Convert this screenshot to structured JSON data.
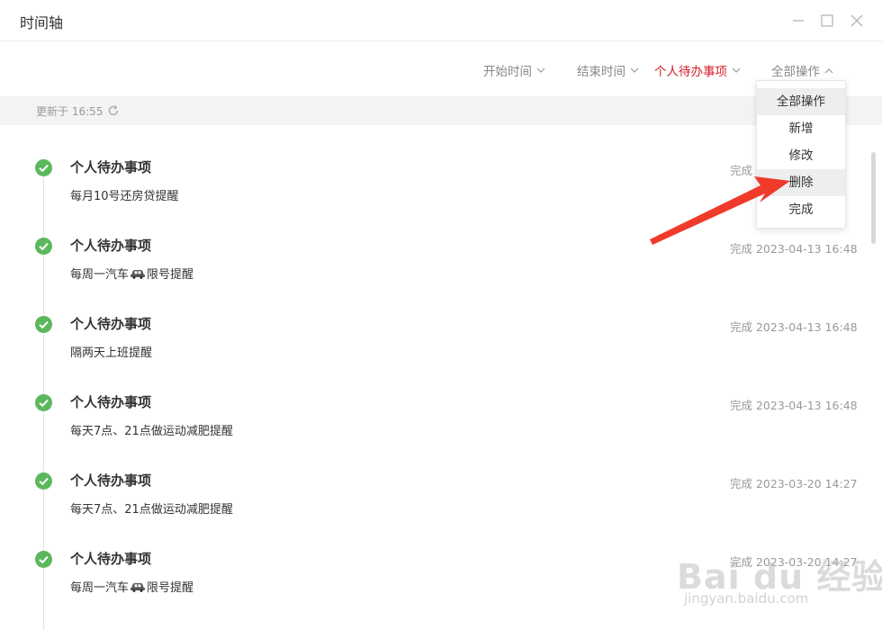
{
  "window": {
    "title": "时间轴",
    "min_icon": "minimize-icon",
    "max_icon": "maximize-icon",
    "close_icon": "close-icon"
  },
  "filters": {
    "start_time": "开始时间",
    "end_time": "结束时间",
    "category": "个人待办事项",
    "all_actions": "全部操作"
  },
  "update": {
    "text": "更新于 16:55",
    "icon": "refresh-icon"
  },
  "items": [
    {
      "category": "个人待办事项",
      "desc": "每月10号还房贷提醒",
      "status": "完成"
    },
    {
      "category": "个人待办事项",
      "desc_before": "每周一汽车",
      "desc_after": "限号提醒",
      "status": "完成 2023-04-13 16:48"
    },
    {
      "category": "个人待办事项",
      "desc": "隔两天上班提醒",
      "status": "完成 2023-04-13 16:48"
    },
    {
      "category": "个人待办事项",
      "desc": "每天7点、21点做运动减肥提醒",
      "status": "完成 2023-04-13 16:48"
    },
    {
      "category": "个人待办事项",
      "desc": "每天7点、21点做运动减肥提醒",
      "status": "完成 2023-03-20 14:27"
    },
    {
      "category": "个人待办事项",
      "desc_before": "每周一汽车",
      "desc_after": "限号提醒",
      "status": "完成 2023-03-20 14:27"
    }
  ],
  "dropdown": {
    "items": [
      "全部操作",
      "新增",
      "修改",
      "删除",
      "完成"
    ]
  },
  "watermark": {
    "logo": "Bai du 经验",
    "url": "jingyan.baidu.com"
  },
  "colors": {
    "accent_red": "#d4202b",
    "check_green": "#5cb85c",
    "arrow_red": "#f03a2a"
  }
}
